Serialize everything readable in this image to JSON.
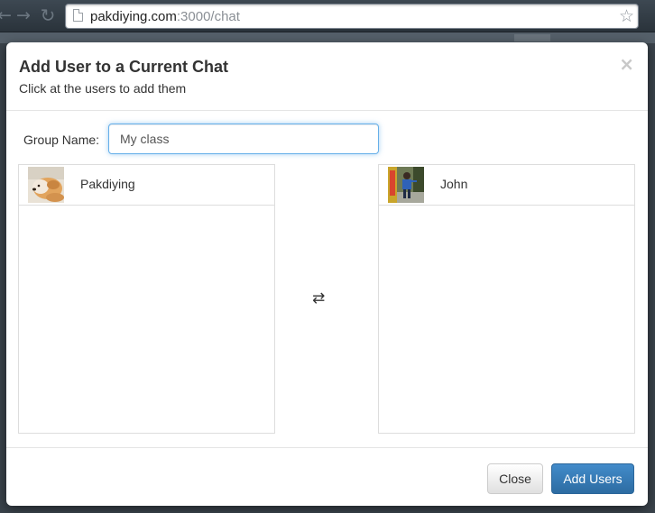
{
  "browser": {
    "back_icon": "back-arrow-icon",
    "forward_icon": "forward-arrow-icon",
    "reload_icon": "reload-icon",
    "url_host": "pakdiying.com",
    "url_path": ":3000/chat",
    "bookmark_icon": "star-icon"
  },
  "modal": {
    "title": "Add User to a Current Chat",
    "subtitle": "Click at the users to add them",
    "close_symbol": "×",
    "group_name_label": "Group Name:",
    "group_name_value": "My class",
    "swap_symbol": "⇄",
    "available_users": [
      {
        "name": "Pakdiying",
        "avatar": "dog-photo-avatar"
      }
    ],
    "selected_users": [
      {
        "name": "John",
        "avatar": "person-photo-avatar"
      }
    ],
    "buttons": {
      "close_label": "Close",
      "add_label": "Add Users"
    },
    "colors": {
      "primary": "#428bca",
      "input_focus": "#66afe9"
    }
  }
}
